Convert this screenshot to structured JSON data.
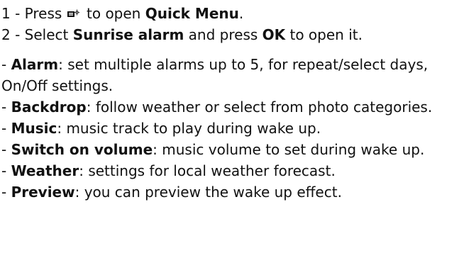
{
  "steps": [
    {
      "prefix": "1 - Press ",
      "icon": "quick-menu-icon",
      "middle": " to open ",
      "strong": "Quick Menu",
      "suffix": "."
    },
    {
      "prefix": "2 - Select ",
      "strong": "Sunrise alarm",
      "middle": " and press ",
      "strong2": "OK",
      "suffix": " to open it."
    }
  ],
  "features": [
    {
      "dash": "- ",
      "term": "Alarm",
      "text": ": set multiple alarms up to 5, for repeat/select days, On/Off settings."
    },
    {
      "dash": "- ",
      "term": "Backdrop",
      "text": ": follow weather or select from photo categories."
    },
    {
      "dash": "- ",
      "term": "Music",
      "text": ": music track to play during wake up."
    },
    {
      "dash": "- ",
      "term": "Switch on volume",
      "text": ": music volume to set during wake up."
    },
    {
      "dash": "- ",
      "term": "Weather",
      "text": ": settings for local weather forecast."
    },
    {
      "dash": "- ",
      "term": "Preview",
      "text": ": you can preview the wake up effect."
    }
  ]
}
